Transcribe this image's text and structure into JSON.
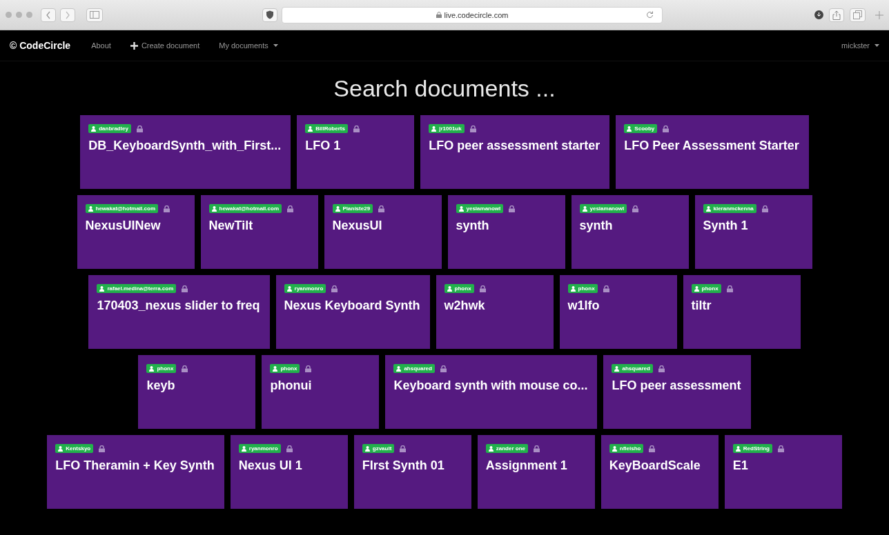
{
  "browser": {
    "url": "live.codecircle.com"
  },
  "navbar": {
    "brand": "© CodeCircle",
    "links": [
      {
        "label": "About",
        "kind": "plain"
      },
      {
        "label": "Create document",
        "kind": "plus"
      },
      {
        "label": "My documents",
        "kind": "dropdown"
      }
    ],
    "user": "mickster"
  },
  "search": {
    "placeholder": "Search documents ..."
  },
  "document_rows": [
    [
      {
        "owner": "danbradley",
        "title": "DB_KeyboardSynth_with_First..."
      },
      {
        "owner": "BillRoberts",
        "title": "LFO 1"
      },
      {
        "owner": "jr1001uk",
        "title": "LFO peer assessment starter"
      },
      {
        "owner": "Scooby",
        "title": "LFO Peer Assessment Starter"
      }
    ],
    [
      {
        "owner": "hewakat@hotmail.com",
        "title": "NexusUINew"
      },
      {
        "owner": "hewakat@hotmail.com",
        "title": "NewTilt"
      },
      {
        "owner": "Pianiste29",
        "title": "NexusUI"
      },
      {
        "owner": "yesiamanowl",
        "title": "synth"
      },
      {
        "owner": "yesiamanowl",
        "title": "synth"
      },
      {
        "owner": "kieranmckenna",
        "title": "Synth 1"
      }
    ],
    [
      {
        "owner": "rafael.medina@terra.com",
        "title": "170403_nexus slider to freq"
      },
      {
        "owner": "ryanmonro",
        "title": "Nexus Keyboard Synth"
      },
      {
        "owner": "phonx",
        "title": "w2hwk"
      },
      {
        "owner": "phonx",
        "title": "w1lfo"
      },
      {
        "owner": "phonx",
        "title": "tiltr"
      }
    ],
    [
      {
        "owner": "phonx",
        "title": "keyb"
      },
      {
        "owner": "phonx",
        "title": "phonui"
      },
      {
        "owner": "ahsquared",
        "title": "Keyboard synth with mouse co..."
      },
      {
        "owner": "ahsquared",
        "title": "LFO peer assessment"
      }
    ],
    [
      {
        "owner": "Kentskyo",
        "title": "LFO Theramin + Key Synth"
      },
      {
        "owner": "ryanmonro",
        "title": "Nexus UI 1"
      },
      {
        "owner": "gzvault",
        "title": "FIrst Synth 01"
      },
      {
        "owner": "zander one",
        "title": "Assignment 1"
      },
      {
        "owner": "nfleisho",
        "title": "KeyBoardScale"
      },
      {
        "owner": "RedString",
        "title": "E1"
      }
    ]
  ]
}
